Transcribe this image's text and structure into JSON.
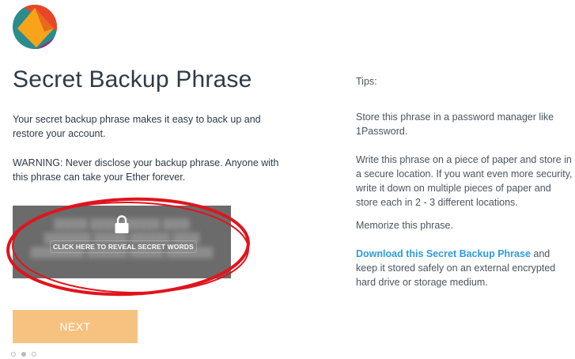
{
  "brand": {
    "colors": {
      "orange": "#f7a41b",
      "red": "#e8462a",
      "teal": "#2a8c8c",
      "purple": "#8b3a7c"
    }
  },
  "page": {
    "title": "Secret Backup Phrase",
    "description": "Your secret backup phrase makes it easy to back up and restore your account.",
    "warning": "WARNING: Never disclose your backup phrase. Anyone with this phrase can take your Ether forever."
  },
  "reveal": {
    "label": "CLICK HERE TO REVEAL SECRET WORDS",
    "icon": "lock-icon",
    "background": "#6b6b6b"
  },
  "annotation": {
    "color": "#e0141c"
  },
  "actions": {
    "next_label": "NEXT",
    "next_color": "#f7c27f"
  },
  "pager": {
    "total": 3,
    "current": 2
  },
  "tips": {
    "heading": "Tips:",
    "items": [
      "Store this phrase in a password manager like 1Password.",
      "Write this phrase on a piece of paper and store in a secure location. If you want even more security, write it down on multiple pieces of paper and store each in 2 - 3 different locations.",
      "Memorize this phrase."
    ],
    "download": {
      "link_text": "Download this Secret Backup Phrase",
      "rest_text": " and keep it stored safely on an external encrypted hard drive or storage medium.",
      "link_color": "#2f9ae0"
    }
  }
}
